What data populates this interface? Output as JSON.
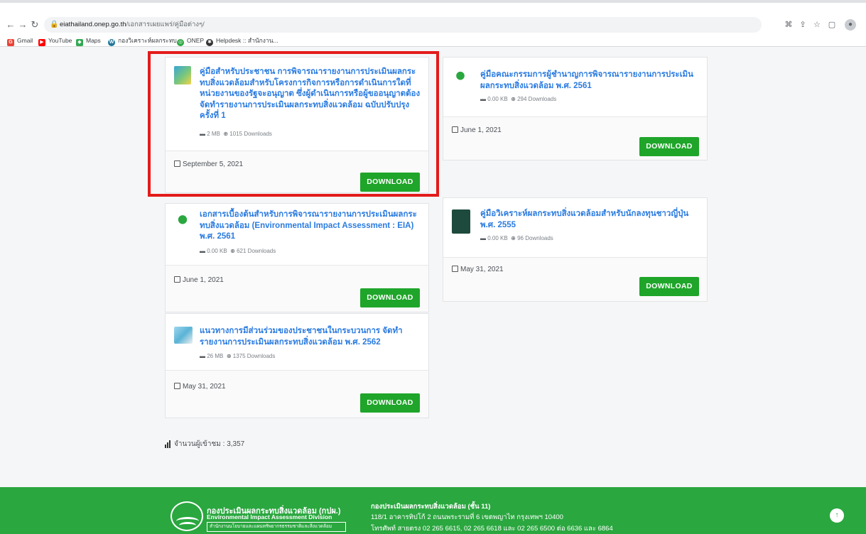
{
  "browser": {
    "url_domain": "eiathailand.onep.go.th",
    "url_path": "/เอกสารเผยแพร่/คู่มือต่างๆ/",
    "bookmarks": [
      {
        "label": "Gmail",
        "icon": "gmail-icon",
        "color": "#ea4335"
      },
      {
        "label": "YouTube",
        "icon": "youtube-icon",
        "color": "#ff0000"
      },
      {
        "label": "Maps",
        "icon": "maps-icon",
        "color": "#34a853"
      },
      {
        "label": "กองวิเคราะห์ผลกระทบ...",
        "icon": "wordpress-icon",
        "color": "#21759b"
      },
      {
        "label": "ONEP",
        "icon": "onep-icon",
        "color": "#2aa73f"
      },
      {
        "label": "Helpdesk :: สำนักงาน...",
        "icon": "helpdesk-icon",
        "color": "#333333"
      }
    ]
  },
  "documents": [
    {
      "title": "คู่มือสำหรับประชาชน การพิจารณารายงานการประเมินผลกระทบสิ่งแวดล้อมสำหรับโครงการกิจการหรือการดำเนินการใดที่หน่วยงานของรัฐจะอนุญาต ซึ่งผู้ดำเนินการหรือผู้ขออนุญาตต้องจัดทำรายงานการประเมินผลกระทบสิ่งแวดล้อม ฉบับปรับปรุง ครั้งที่ 1",
      "size": "2 MB",
      "downloads": "1015 Downloads",
      "date": "September 5, 2021",
      "button": "DOWNLOAD",
      "highlighted": true
    },
    {
      "title": "คู่มือคณะกรรมการผู้ชำนาญการพิจารณารายงานการประเมินผลกระทบสิ่งแวดล้อม พ.ศ. 2561",
      "size": "0.00 KB",
      "downloads": "294 Downloads",
      "date": "June 1, 2021",
      "button": "DOWNLOAD",
      "highlighted": false
    },
    {
      "title": "เอกสารเบื้องต้นสำหรับการพิจารณารายงานการประเมินผลกระทบสิ่งแวดล้อม (Environmental Impact Assessment : EIA) พ.ศ. 2561",
      "size": "0.00 KB",
      "downloads": "621 Downloads",
      "date": "June 1, 2021",
      "button": "DOWNLOAD",
      "highlighted": false
    },
    {
      "title": "คู่มือวิเคราะห์ผลกระทบสิ่งแวดล้อมสำหรับนักลงทุนชาวญี่ปุ่น พ.ศ. 2555",
      "size": "0.00 KB",
      "downloads": "96 Downloads",
      "date": "May 31, 2021",
      "button": "DOWNLOAD",
      "highlighted": false
    },
    {
      "title": "แนวทางการมีส่วนร่วมของประชาชนในกระบวนการ จัดทำรายงานการประเมินผลกระทบสิ่งแวดล้อม พ.ศ. 2562",
      "size": "26 MB",
      "downloads": "1375 Downloads",
      "date": "May 31, 2021",
      "button": "DOWNLOAD",
      "highlighted": false
    }
  ],
  "visitors": "จำนวนผู้เข้าชม : 3,357",
  "footer": {
    "org_th": "กองประเมินผลกระทบสิ่งแวดล้อม (กปผ.)",
    "org_en": "Environmental Impact Assessment Division",
    "org_parent": "สำนักงานนโยบายและแผนทรัพยากรธรรมชาติและสิ่งแวดล้อม",
    "address_title": "กองประเมินผลกระทบสิ่งแวดล้อม (ชั้น 11)",
    "address_line": "118/1 อาคารทิปโก้ 2 ถนนพระรามที่ 6 เขตพญาไท กรุงเทพฯ 10400",
    "phone_line": "โทรศัพท์ สายตรง 02 265 6615, 02 265 6618 และ 02 265 6500 ต่อ 6636 และ 6864"
  },
  "colors": {
    "title_link": "#2a7be0",
    "download_button": "#1fa52a",
    "highlight_border": "#e41b1b",
    "footer": "#2aa73f"
  }
}
